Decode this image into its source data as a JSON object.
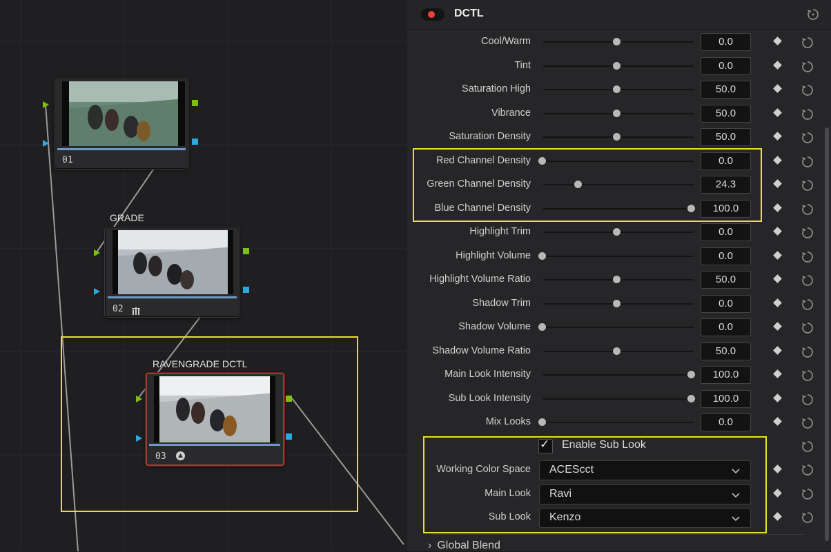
{
  "graph": {
    "nodes": [
      {
        "number": "01",
        "label": "",
        "icon": ""
      },
      {
        "number": "02",
        "label": "GRADE",
        "icon": "bars-icon"
      },
      {
        "number": "03",
        "label": "RAVENGRADE DCTL",
        "icon": "dctl-icon"
      }
    ]
  },
  "panel": {
    "title": "DCTL",
    "toggle_on": true,
    "params": [
      {
        "label": "Cool/Warm",
        "value": "0.0",
        "fraction": 0.5
      },
      {
        "label": "Tint",
        "value": "0.0",
        "fraction": 0.5
      },
      {
        "label": "Saturation High",
        "value": "50.0",
        "fraction": 0.5
      },
      {
        "label": "Vibrance",
        "value": "50.0",
        "fraction": 0.5
      },
      {
        "label": "Saturation Density",
        "value": "50.0",
        "fraction": 0.5
      },
      {
        "label": "Red Channel Density",
        "value": "0.0",
        "fraction": 0.0
      },
      {
        "label": "Green Channel Density",
        "value": "24.3",
        "fraction": 0.243
      },
      {
        "label": "Blue Channel Density",
        "value": "100.0",
        "fraction": 1.0
      },
      {
        "label": "Highlight Trim",
        "value": "0.0",
        "fraction": 0.5
      },
      {
        "label": "Highlight Volume",
        "value": "0.0",
        "fraction": 0.0
      },
      {
        "label": "Highlight Volume Ratio",
        "value": "50.0",
        "fraction": 0.5
      },
      {
        "label": "Shadow Trim",
        "value": "0.0",
        "fraction": 0.5
      },
      {
        "label": "Shadow Volume",
        "value": "0.0",
        "fraction": 0.0
      },
      {
        "label": "Shadow Volume Ratio",
        "value": "50.0",
        "fraction": 0.5
      },
      {
        "label": "Main Look Intensity",
        "value": "100.0",
        "fraction": 1.0
      },
      {
        "label": "Sub Look Intensity",
        "value": "100.0",
        "fraction": 1.0
      },
      {
        "label": "Mix Looks",
        "value": "0.0",
        "fraction": 0.0
      }
    ],
    "enable_sub_look": {
      "label": "Enable Sub Look",
      "checked": true
    },
    "dropdowns": [
      {
        "label": "Working Color Space",
        "value": "ACEScct"
      },
      {
        "label": "Main Look",
        "value": "Ravi"
      },
      {
        "label": "Sub Look",
        "value": "Kenzo"
      }
    ],
    "section": "Global Blend"
  },
  "colors": {
    "highlight": "#e6e12a",
    "port_green": "#7cc110",
    "port_blue": "#2fa8e0",
    "toggle_dot": "#e8433a",
    "selected_border": "#a23a34"
  }
}
